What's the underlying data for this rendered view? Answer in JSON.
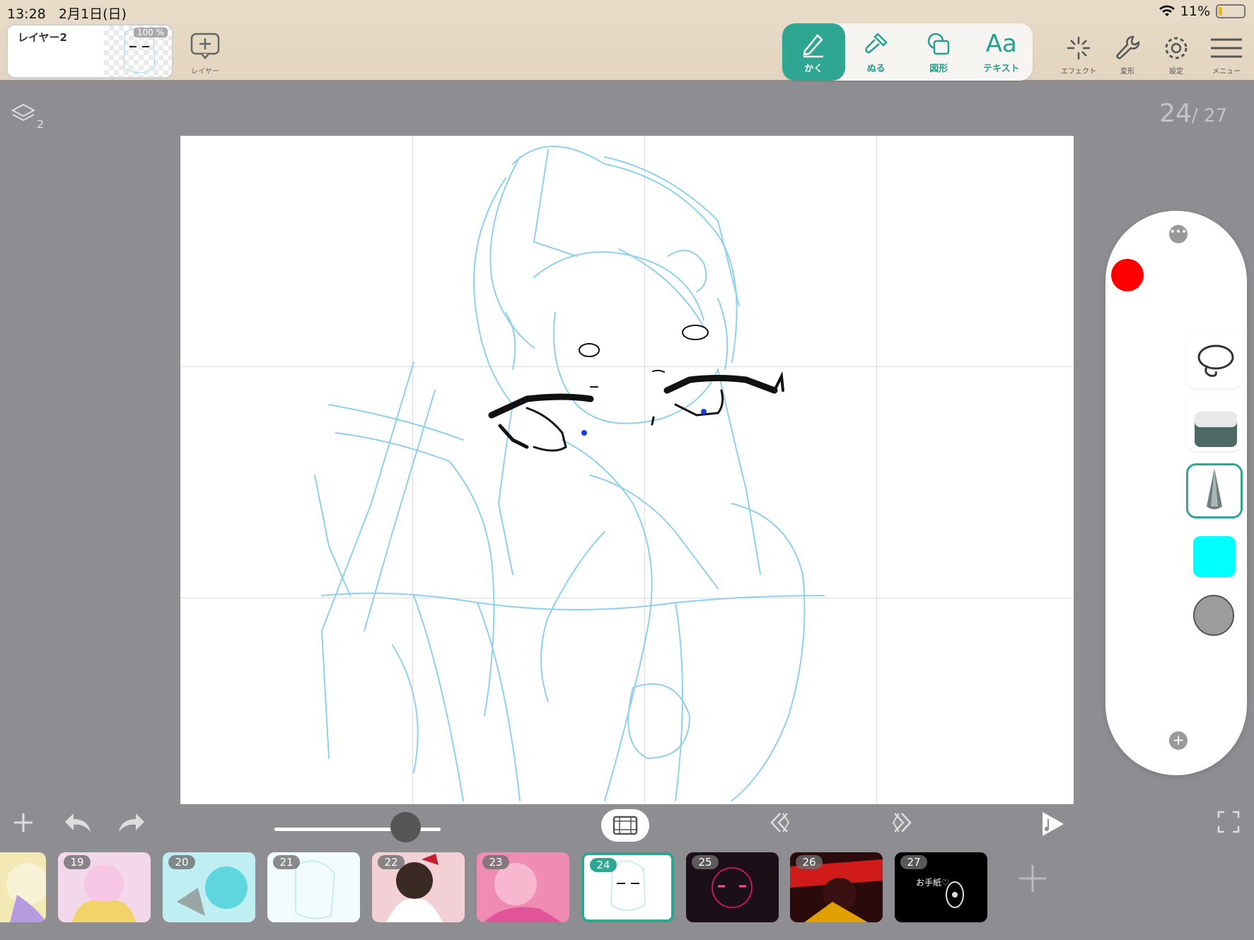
{
  "status": {
    "time": "13:28",
    "date": "2月1日(日)",
    "battery": "11%"
  },
  "layer": {
    "name": "レイヤー2",
    "opacity": "100 %",
    "add_label": "レイヤー"
  },
  "tools": [
    {
      "label": "かく",
      "icon": "pencil-icon",
      "active": true
    },
    {
      "label": "ぬる",
      "icon": "fill-brush-icon",
      "active": false
    },
    {
      "label": "図形",
      "icon": "shape-icon",
      "active": false
    },
    {
      "label": "テキスト",
      "icon": "text-icon",
      "glyph": "Aa",
      "active": false
    }
  ],
  "toolbar": {
    "effect": "エフェクト",
    "transform": "変形",
    "settings": "設定",
    "menu": "メニュー"
  },
  "canvas": {
    "layer_count": "2",
    "frame_current": "24",
    "frame_total": "/ 27"
  },
  "brush_panel": {
    "color_primary": "#ff0000",
    "color_secondary": "#00ffff",
    "color_tertiary": "#9c9c9c",
    "selected_tool": "pen"
  },
  "timeline": {
    "current": "24",
    "frames": [
      {
        "num": "",
        "color": "#f3e9b5"
      },
      {
        "num": "19",
        "color": "#f2d8ea"
      },
      {
        "num": "20",
        "color": "#bfeff2"
      },
      {
        "num": "21",
        "color": "#f2fbfd"
      },
      {
        "num": "22",
        "color": "#f3cfd6"
      },
      {
        "num": "23",
        "color": "#f08bb2"
      },
      {
        "num": "24",
        "color": "#ffffff"
      },
      {
        "num": "25",
        "color": "#1b0f18"
      },
      {
        "num": "26",
        "color": "#2a0a0a"
      },
      {
        "num": "27",
        "color": "#000000",
        "note": "お手紙♡"
      }
    ]
  }
}
